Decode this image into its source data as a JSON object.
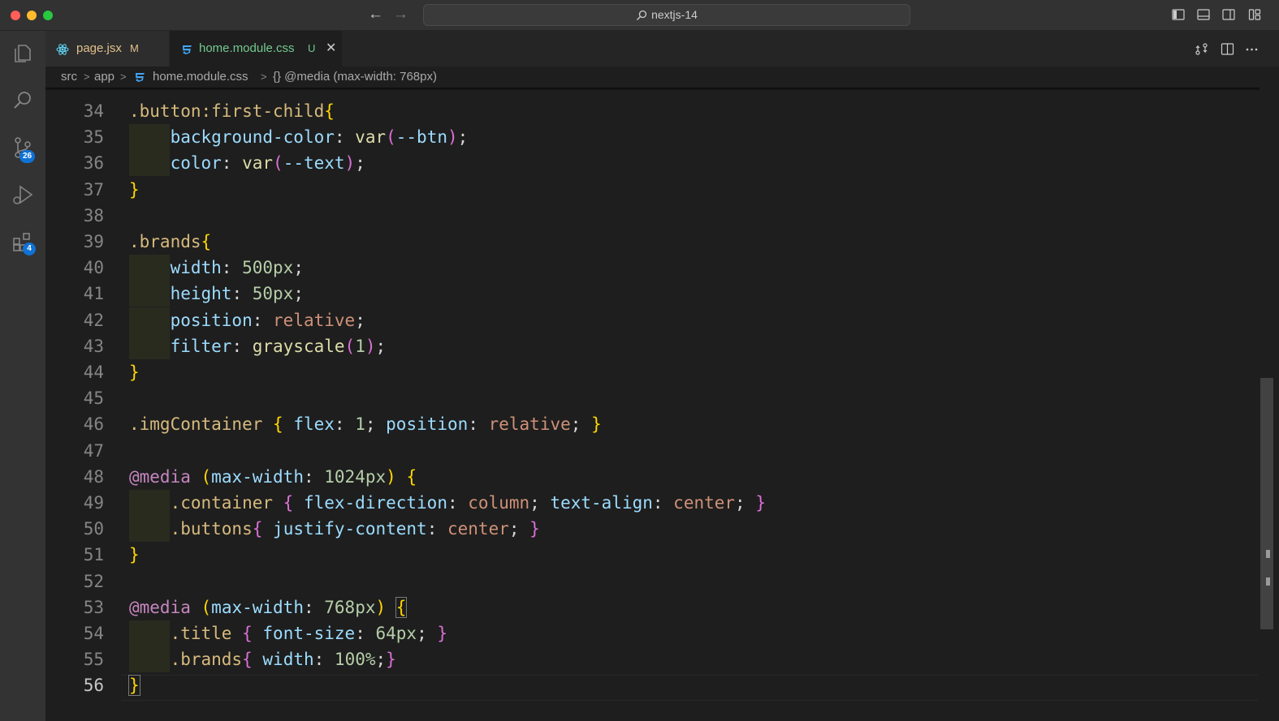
{
  "window": {
    "title": "nextjs-14",
    "nav_back": "←",
    "nav_forward": "→"
  },
  "activity_bar": {
    "items": [
      {
        "name": "explorer-icon"
      },
      {
        "name": "search-icon"
      },
      {
        "name": "source-control-icon",
        "badge": "26"
      },
      {
        "name": "run-debug-icon"
      },
      {
        "name": "extensions-icon",
        "badge": "4"
      }
    ],
    "badge_color": "#0e72d6"
  },
  "tabs": [
    {
      "label": "page.jsx",
      "status": "M",
      "icon": "react-icon",
      "active": false
    },
    {
      "label": "home.module.css",
      "status": "U",
      "icon": "css-icon",
      "active": true,
      "close": "✕"
    }
  ],
  "breadcrumb": {
    "items": [
      "src",
      "app",
      "home.module.css",
      "{} @media (max-width: 768px)"
    ],
    "separator": ">"
  },
  "editor": {
    "current_line": 56,
    "lines": [
      {
        "no": "34",
        "tokens": [
          {
            "t": ".button:first-child",
            "c": "sel"
          },
          {
            "t": "{",
            "c": "br1"
          }
        ]
      },
      {
        "no": "35",
        "guide": true,
        "tokens": [
          {
            "t": "    ",
            "c": "pun"
          },
          {
            "t": "background-color",
            "c": "prop"
          },
          {
            "t": ": ",
            "c": "pun"
          },
          {
            "t": "var",
            "c": "fn"
          },
          {
            "t": "(",
            "c": "br2"
          },
          {
            "t": "--btn",
            "c": "var"
          },
          {
            "t": ")",
            "c": "br2"
          },
          {
            "t": ";",
            "c": "pun"
          }
        ]
      },
      {
        "no": "36",
        "guide": true,
        "tokens": [
          {
            "t": "    ",
            "c": "pun"
          },
          {
            "t": "color",
            "c": "prop"
          },
          {
            "t": ": ",
            "c": "pun"
          },
          {
            "t": "var",
            "c": "fn"
          },
          {
            "t": "(",
            "c": "br2"
          },
          {
            "t": "--text",
            "c": "var"
          },
          {
            "t": ")",
            "c": "br2"
          },
          {
            "t": ";",
            "c": "pun"
          }
        ]
      },
      {
        "no": "37",
        "tokens": [
          {
            "t": "}",
            "c": "br1"
          }
        ]
      },
      {
        "no": "38",
        "tokens": []
      },
      {
        "no": "39",
        "tokens": [
          {
            "t": ".brands",
            "c": "sel"
          },
          {
            "t": "{",
            "c": "br1"
          }
        ]
      },
      {
        "no": "40",
        "guide": true,
        "tokens": [
          {
            "t": "    ",
            "c": "pun"
          },
          {
            "t": "width",
            "c": "prop"
          },
          {
            "t": ": ",
            "c": "pun"
          },
          {
            "t": "500px",
            "c": "num"
          },
          {
            "t": ";",
            "c": "pun"
          }
        ]
      },
      {
        "no": "41",
        "guide": true,
        "tokens": [
          {
            "t": "    ",
            "c": "pun"
          },
          {
            "t": "height",
            "c": "prop"
          },
          {
            "t": ": ",
            "c": "pun"
          },
          {
            "t": "50px",
            "c": "num"
          },
          {
            "t": ";",
            "c": "pun"
          }
        ]
      },
      {
        "no": "42",
        "guide": true,
        "tokens": [
          {
            "t": "    ",
            "c": "pun"
          },
          {
            "t": "position",
            "c": "prop"
          },
          {
            "t": ": ",
            "c": "pun"
          },
          {
            "t": "relative",
            "c": "val"
          },
          {
            "t": ";",
            "c": "pun"
          }
        ]
      },
      {
        "no": "43",
        "guide": true,
        "tokens": [
          {
            "t": "    ",
            "c": "pun"
          },
          {
            "t": "filter",
            "c": "prop"
          },
          {
            "t": ": ",
            "c": "pun"
          },
          {
            "t": "grayscale",
            "c": "fn"
          },
          {
            "t": "(",
            "c": "br2"
          },
          {
            "t": "1",
            "c": "num"
          },
          {
            "t": ")",
            "c": "br2"
          },
          {
            "t": ";",
            "c": "pun"
          }
        ]
      },
      {
        "no": "44",
        "tokens": [
          {
            "t": "}",
            "c": "br1"
          }
        ]
      },
      {
        "no": "45",
        "tokens": []
      },
      {
        "no": "46",
        "tokens": [
          {
            "t": ".imgContainer ",
            "c": "sel"
          },
          {
            "t": "{",
            "c": "br1"
          },
          {
            "t": " ",
            "c": "pun"
          },
          {
            "t": "flex",
            "c": "prop"
          },
          {
            "t": ": ",
            "c": "pun"
          },
          {
            "t": "1",
            "c": "num"
          },
          {
            "t": "; ",
            "c": "pun"
          },
          {
            "t": "position",
            "c": "prop"
          },
          {
            "t": ": ",
            "c": "pun"
          },
          {
            "t": "relative",
            "c": "val"
          },
          {
            "t": "; ",
            "c": "pun"
          },
          {
            "t": "}",
            "c": "br1"
          }
        ]
      },
      {
        "no": "47",
        "tokens": []
      },
      {
        "no": "48",
        "tokens": [
          {
            "t": "@media ",
            "c": "at"
          },
          {
            "t": "(",
            "c": "br1"
          },
          {
            "t": "max-width",
            "c": "prop"
          },
          {
            "t": ": ",
            "c": "pun"
          },
          {
            "t": "1024px",
            "c": "num"
          },
          {
            "t": ")",
            "c": "br1"
          },
          {
            "t": " ",
            "c": "pun"
          },
          {
            "t": "{",
            "c": "br1"
          }
        ]
      },
      {
        "no": "49",
        "guide": true,
        "tokens": [
          {
            "t": "    ",
            "c": "pun"
          },
          {
            "t": ".container ",
            "c": "sel"
          },
          {
            "t": "{",
            "c": "br2"
          },
          {
            "t": " ",
            "c": "pun"
          },
          {
            "t": "flex-direction",
            "c": "prop"
          },
          {
            "t": ": ",
            "c": "pun"
          },
          {
            "t": "column",
            "c": "val"
          },
          {
            "t": "; ",
            "c": "pun"
          },
          {
            "t": "text-align",
            "c": "prop"
          },
          {
            "t": ": ",
            "c": "pun"
          },
          {
            "t": "center",
            "c": "val"
          },
          {
            "t": "; ",
            "c": "pun"
          },
          {
            "t": "}",
            "c": "br2"
          }
        ]
      },
      {
        "no": "50",
        "guide": true,
        "tokens": [
          {
            "t": "    ",
            "c": "pun"
          },
          {
            "t": ".buttons",
            "c": "sel"
          },
          {
            "t": "{",
            "c": "br2"
          },
          {
            "t": " ",
            "c": "pun"
          },
          {
            "t": "justify-content",
            "c": "prop"
          },
          {
            "t": ": ",
            "c": "pun"
          },
          {
            "t": "center",
            "c": "val"
          },
          {
            "t": "; ",
            "c": "pun"
          },
          {
            "t": "}",
            "c": "br2"
          }
        ]
      },
      {
        "no": "51",
        "tokens": [
          {
            "t": "}",
            "c": "br1"
          }
        ]
      },
      {
        "no": "52",
        "tokens": []
      },
      {
        "no": "53",
        "tokens": [
          {
            "t": "@media ",
            "c": "at"
          },
          {
            "t": "(",
            "c": "br1"
          },
          {
            "t": "max-width",
            "c": "prop"
          },
          {
            "t": ": ",
            "c": "pun"
          },
          {
            "t": "768px",
            "c": "num"
          },
          {
            "t": ")",
            "c": "br1"
          },
          {
            "t": " ",
            "c": "pun"
          },
          {
            "t": "{",
            "c": "br1",
            "cursor": true
          }
        ]
      },
      {
        "no": "54",
        "guide": true,
        "tokens": [
          {
            "t": "    ",
            "c": "pun"
          },
          {
            "t": ".title ",
            "c": "sel"
          },
          {
            "t": "{",
            "c": "br2"
          },
          {
            "t": " ",
            "c": "pun"
          },
          {
            "t": "font-size",
            "c": "prop"
          },
          {
            "t": ": ",
            "c": "pun"
          },
          {
            "t": "64px",
            "c": "num"
          },
          {
            "t": "; ",
            "c": "pun"
          },
          {
            "t": "}",
            "c": "br2"
          }
        ]
      },
      {
        "no": "55",
        "guide": true,
        "tokens": [
          {
            "t": "    ",
            "c": "pun"
          },
          {
            "t": ".brands",
            "c": "sel"
          },
          {
            "t": "{",
            "c": "br2"
          },
          {
            "t": " ",
            "c": "pun"
          },
          {
            "t": "width",
            "c": "prop"
          },
          {
            "t": ": ",
            "c": "pun"
          },
          {
            "t": "100%",
            "c": "num"
          },
          {
            "t": ";",
            "c": "pun"
          },
          {
            "t": "}",
            "c": "br2"
          }
        ]
      },
      {
        "no": "56",
        "tokens": [
          {
            "t": "}",
            "c": "br1",
            "cursor": true
          }
        ]
      }
    ]
  }
}
